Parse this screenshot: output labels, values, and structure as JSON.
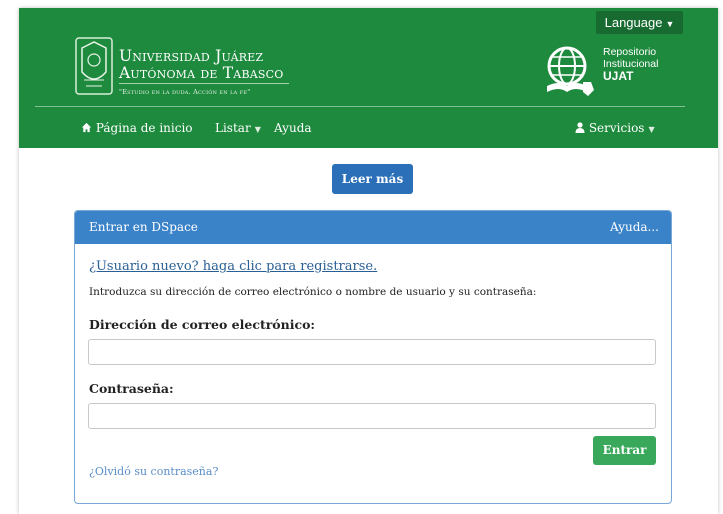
{
  "header": {
    "language_label": "Language",
    "university_line1": "Universidad Juárez",
    "university_line2": "Autónoma de Tabasco",
    "university_motto": "\"Estudio en la duda. Acción en la fe\"",
    "repo_line1": "Repositorio",
    "repo_line2": "Institucional",
    "repo_line3": "UJAT"
  },
  "nav": {
    "home": "Página de inicio",
    "list": "Listar",
    "help": "Ayuda",
    "services": "Servicios"
  },
  "main": {
    "read_more": "Leer más",
    "panel_title": "Entrar en DSpace",
    "panel_help": "Ayuda...",
    "register_link": "¿Usuario nuevo? haga clic para registrarse.",
    "instructions": "Introduzca su dirección de correo electrónico o nombre de usuario y su contraseña:",
    "email_label": "Dirección de correo electrónico:",
    "email_value": "",
    "password_label": "Contraseña:",
    "password_value": "",
    "enter_button": "Entrar",
    "forgot_link": "¿Olvidó su contraseña?"
  },
  "colors": {
    "header_green": "#1e8a3e",
    "panel_blue": "#3b83c9",
    "button_blue": "#2a6fb8",
    "button_green": "#39a85a"
  },
  "icons": [
    "home-icon",
    "user-icon",
    "caret-down-icon"
  ]
}
